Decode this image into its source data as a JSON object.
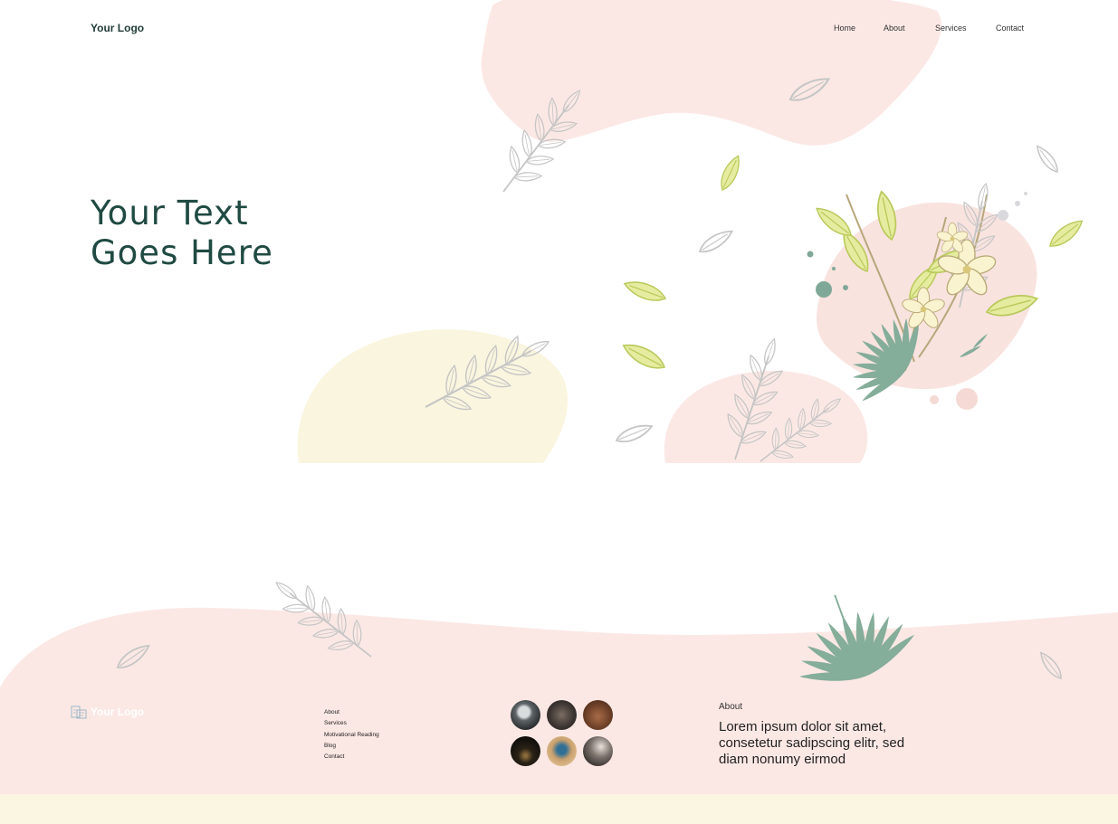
{
  "header": {
    "logo": "Your Logo",
    "nav": [
      "Home",
      "About",
      "Services",
      "Contact"
    ]
  },
  "hero": {
    "title_line1": "Your Text",
    "title_line2": "Goes Here"
  },
  "footer": {
    "logo": "Your Logo",
    "links": [
      "About",
      "Services",
      "Motivational Reading",
      "Blog",
      "Contact"
    ],
    "gallery_icons": [
      "photo-thumbnail",
      "photo-thumbnail",
      "photo-thumbnail",
      "photo-thumbnail",
      "photo-thumbnail",
      "photo-thumbnail"
    ],
    "about_heading": "About",
    "about_text": "Lorem ipsum dolor sit amet, consetetur sadipscing elitr, sed diam nonumy eirmod"
  },
  "colors": {
    "blush": "#fbe8e4",
    "cream": "#faf5de",
    "leaf_outline": "#c4c4c4",
    "leaf_green": "#85ae9b",
    "leaf_lime": "#d9e58a",
    "heading": "#1f4a42"
  }
}
